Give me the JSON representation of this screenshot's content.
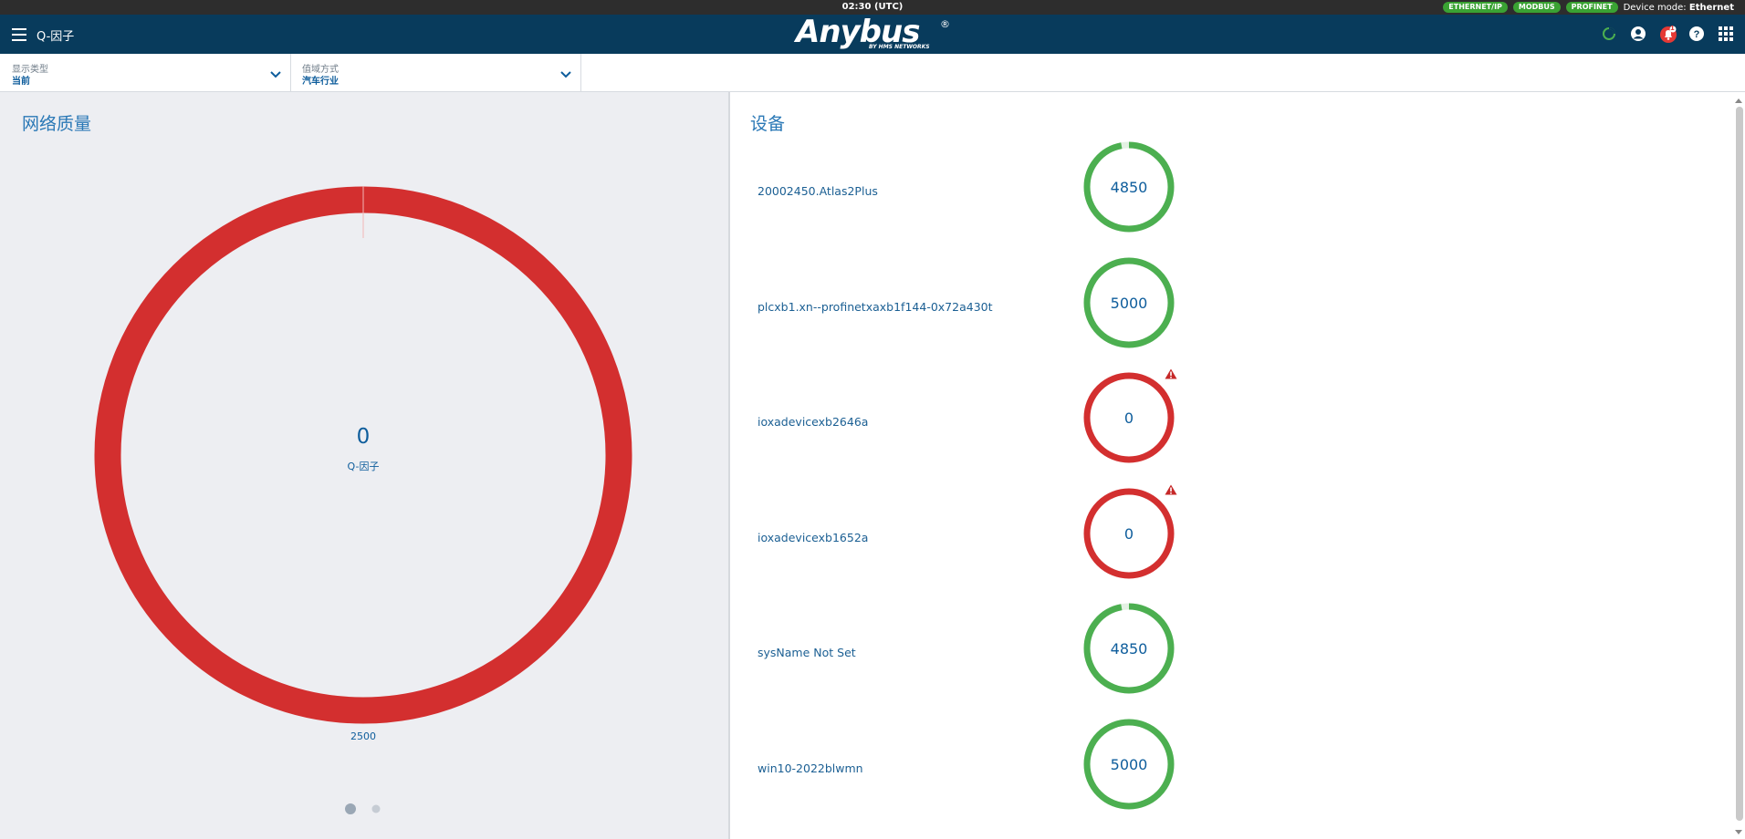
{
  "topbar": {
    "time": "02:30 (UTC)",
    "badges": [
      "ETHERNET/IP",
      "MODBUS",
      "PROFINET"
    ],
    "device_mode_label": "Device mode:",
    "device_mode_value": "Ethernet"
  },
  "header": {
    "title": "Q-因子",
    "logo_text": "Anybus",
    "logo_sub": "BY HMS NETWORKS",
    "logo_reg": "®",
    "icons": [
      "status-ring-icon",
      "user-icon",
      "notification-bell-icon",
      "help-icon",
      "apps-grid-icon"
    ],
    "notification_count": "1"
  },
  "filters": {
    "display_type": {
      "label": "显示类型",
      "value": "当前"
    },
    "threshold_mode": {
      "label": "值域方式",
      "value": "汽车行业"
    }
  },
  "network_quality": {
    "title": "网络质量",
    "value": "0",
    "value_label": "Q-因子",
    "bottom_label": "2500",
    "fraction": 0,
    "ring_color": "#d32f2f",
    "pager_pages": 2,
    "pager_active": 0
  },
  "devices": {
    "title": "设备",
    "items": [
      {
        "name": "20002450.Atlas2Plus",
        "value": "4850",
        "fraction": 0.97,
        "status": "ok",
        "warning": false
      },
      {
        "name": "plcxb1.xn--profinetxaxb1f144-0x72a430t",
        "value": "5000",
        "fraction": 1,
        "status": "ok",
        "warning": false
      },
      {
        "name": "ioxadevicexb2646a",
        "value": "0",
        "fraction": 0,
        "status": "bad",
        "warning": true
      },
      {
        "name": "ioxadevicexb1652a",
        "value": "0",
        "fraction": 0,
        "status": "bad",
        "warning": true
      },
      {
        "name": "sysName Not Set",
        "value": "4850",
        "fraction": 0.97,
        "status": "ok",
        "warning": false
      },
      {
        "name": "win10-2022blwmn",
        "value": "5000",
        "fraction": 1,
        "status": "ok",
        "warning": false
      }
    ]
  },
  "colors": {
    "ok": "#4caf50",
    "bad": "#d32f2f",
    "brand": "#083b5c",
    "accent": "#2a78b6"
  }
}
